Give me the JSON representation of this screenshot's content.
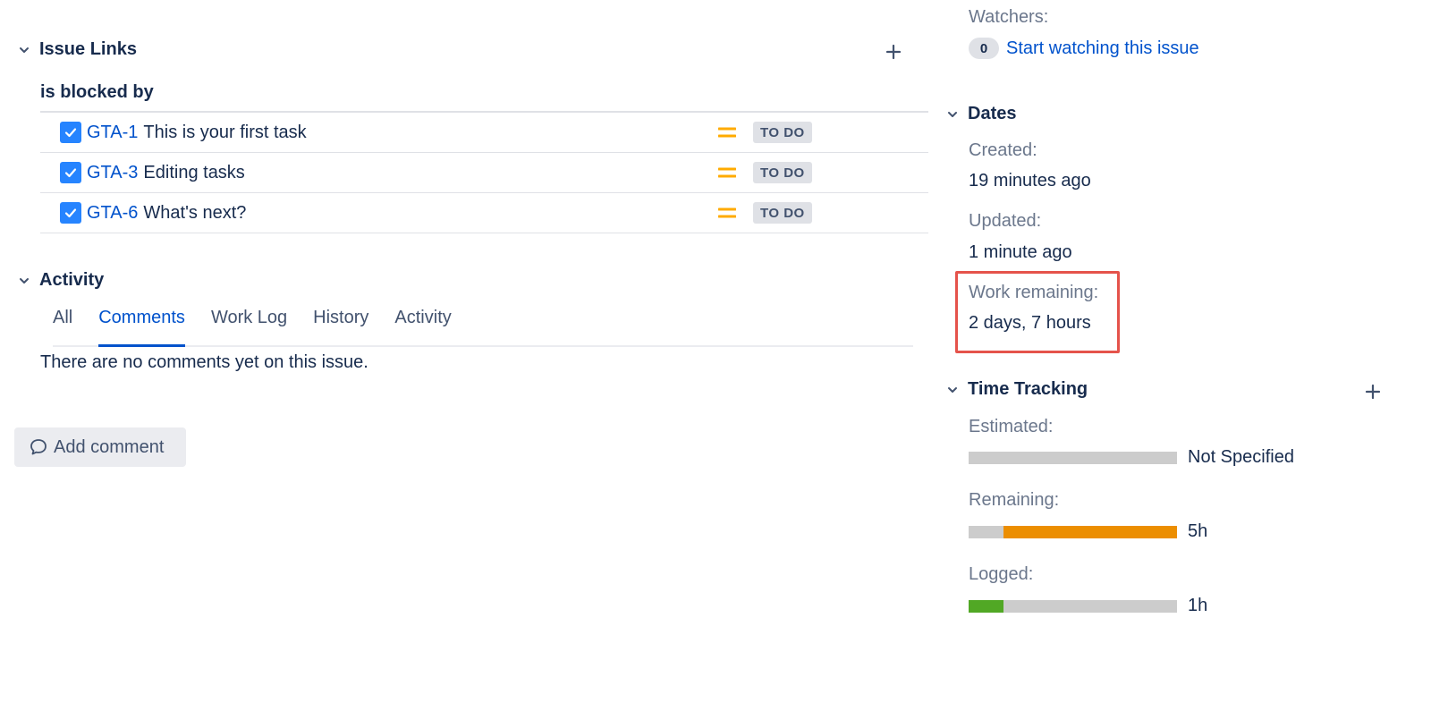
{
  "issue_links": {
    "title": "Issue Links",
    "relation": "is blocked by",
    "items": [
      {
        "key": "GTA-1",
        "summary": "This is your first task",
        "status": "TO DO",
        "priority_icon": "priority-medium-icon"
      },
      {
        "key": "GTA-3",
        "summary": "Editing tasks",
        "status": "TO DO",
        "priority_icon": "priority-medium-icon"
      },
      {
        "key": "GTA-6",
        "summary": "What's next?",
        "status": "TO DO",
        "priority_icon": "priority-medium-icon"
      }
    ]
  },
  "activity": {
    "title": "Activity",
    "tabs": [
      {
        "label": "All",
        "active": false
      },
      {
        "label": "Comments",
        "active": true
      },
      {
        "label": "Work Log",
        "active": false
      },
      {
        "label": "History",
        "active": false
      },
      {
        "label": "Activity",
        "active": false
      }
    ],
    "empty_message": "There are no comments yet on this issue.",
    "add_comment_label": "Add comment"
  },
  "people": {
    "watchers_label": "Watchers:",
    "watchers_count": "0",
    "watch_link": "Start watching this issue"
  },
  "dates": {
    "title": "Dates",
    "created_label": "Created:",
    "created_value": "19 minutes ago",
    "updated_label": "Updated:",
    "updated_value": "1 minute ago",
    "work_remaining_label": "Work remaining:",
    "work_remaining_value": "2 days, 7 hours"
  },
  "time_tracking": {
    "title": "Time Tracking",
    "estimated_label": "Estimated:",
    "estimated_value": "Not Specified",
    "estimated_fraction": 0,
    "remaining_label": "Remaining:",
    "remaining_value": "5h",
    "remaining_fraction": 0.833,
    "logged_label": "Logged:",
    "logged_value": "1h",
    "logged_fraction": 0.167
  },
  "colors": {
    "link": "#0052cc",
    "remaining_bar": "#ec8e00",
    "logged_bar": "#51a825",
    "priority_medium": "#ffab00",
    "highlight_border": "#e5534b"
  }
}
